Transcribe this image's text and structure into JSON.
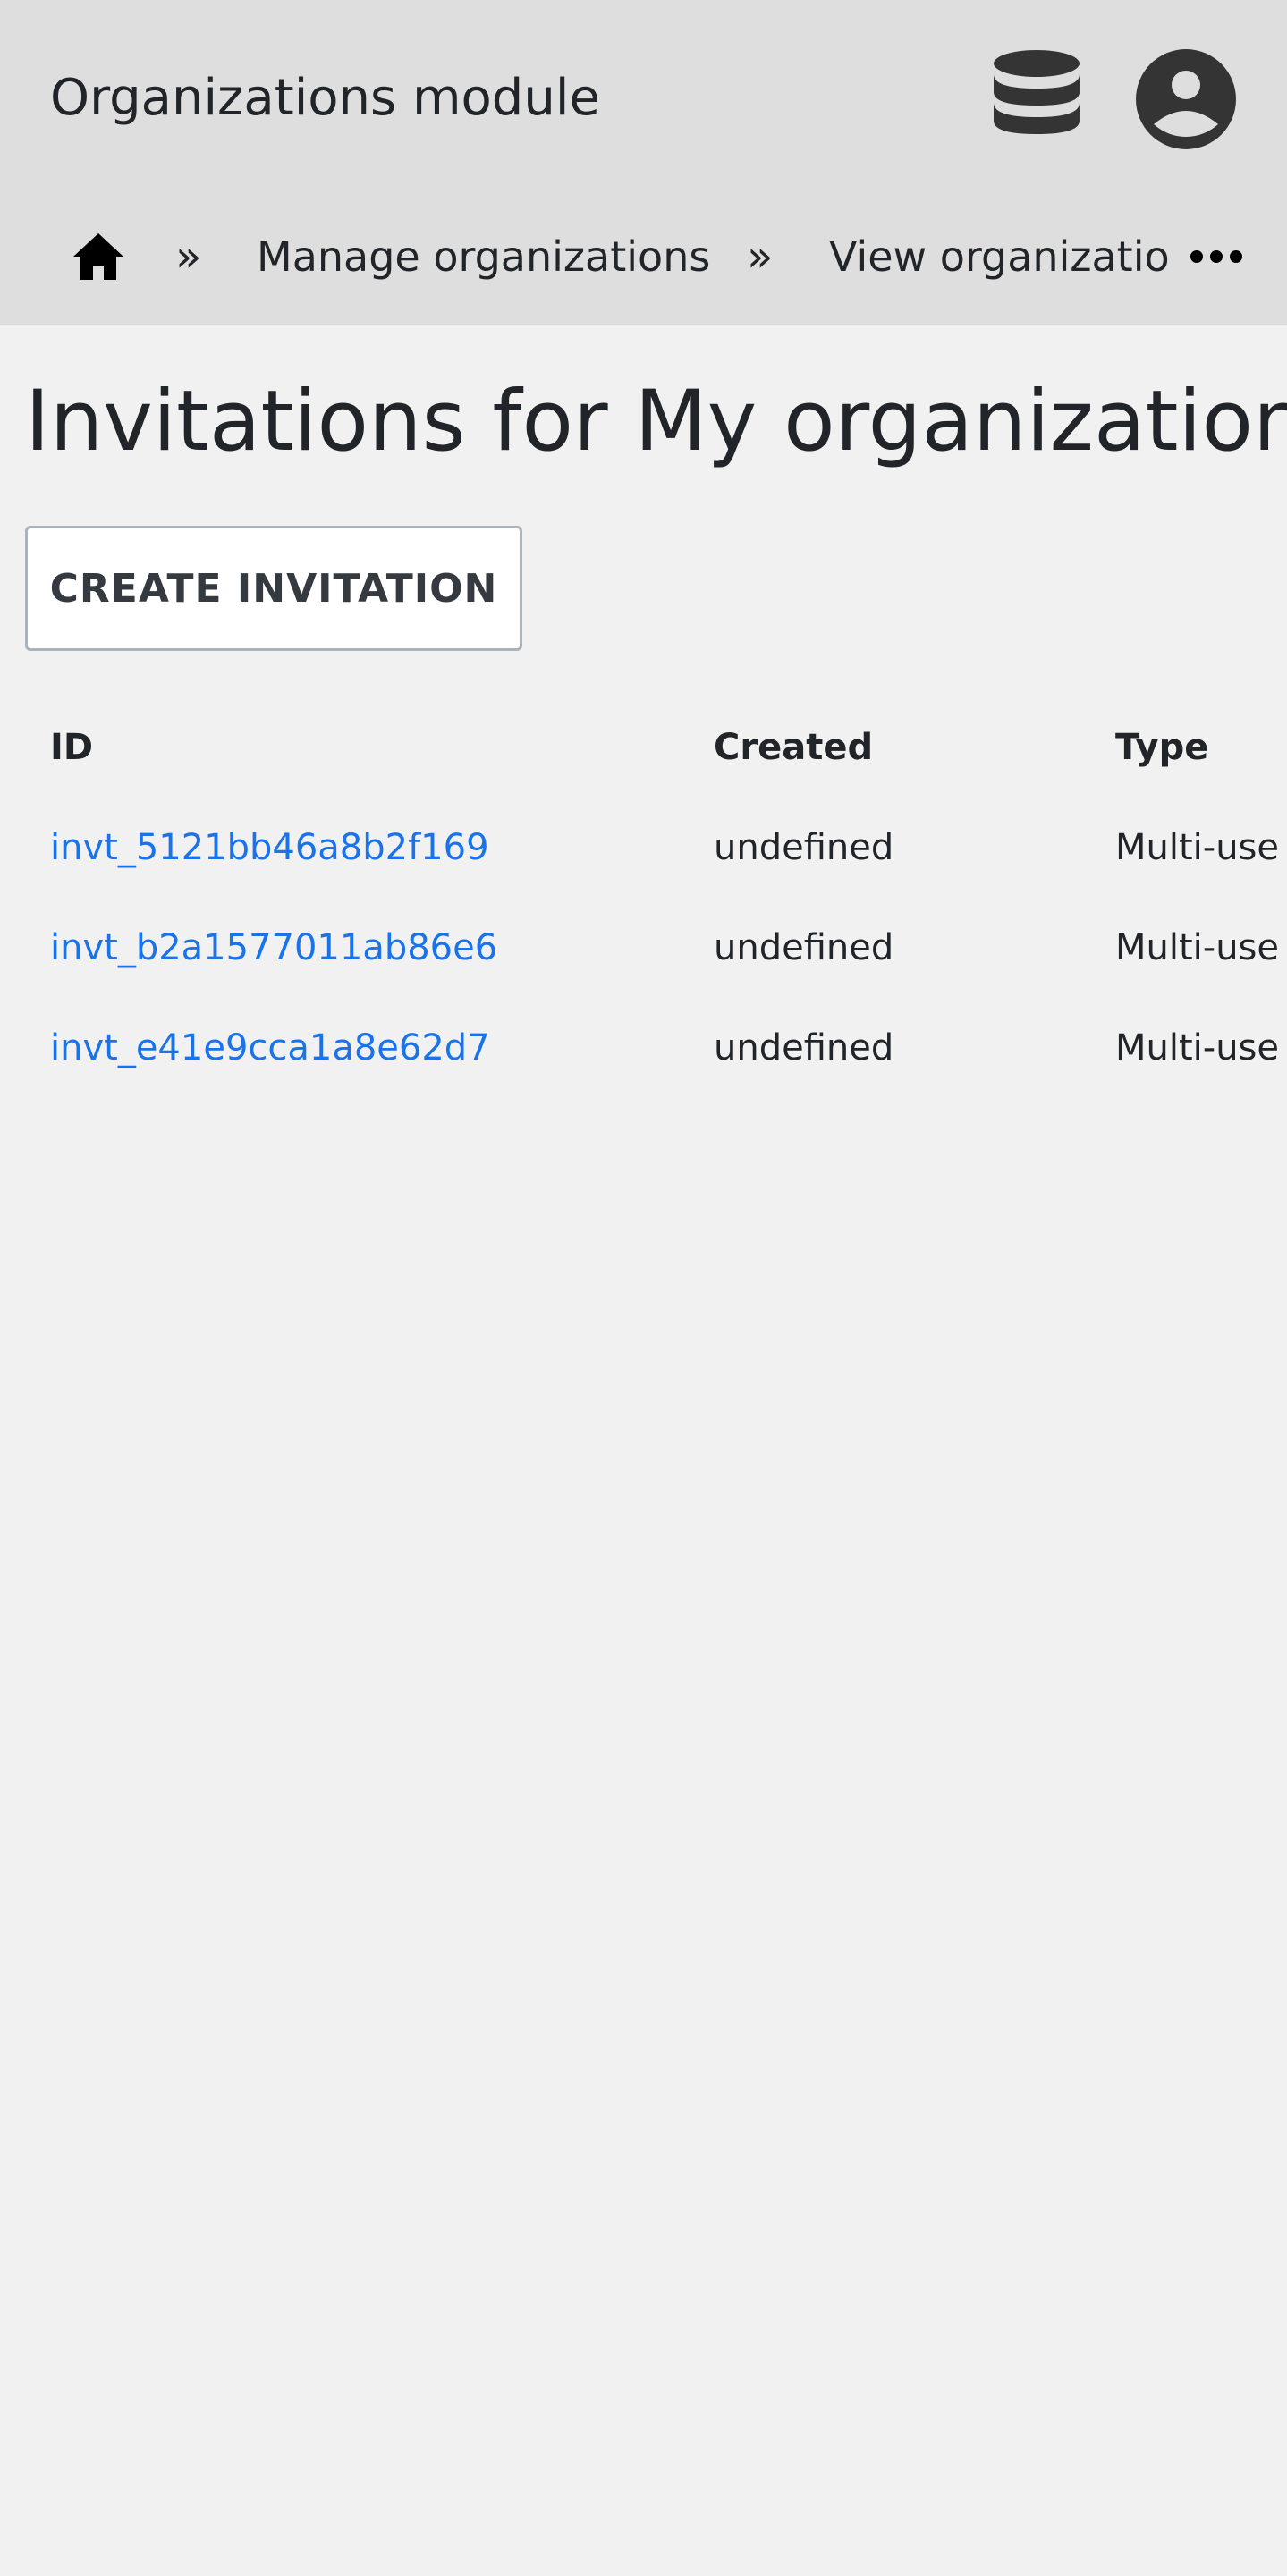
{
  "header": {
    "app_title": "Organizations module",
    "icons": [
      "database-icon",
      "account-circle-icon"
    ]
  },
  "breadcrumb": {
    "home_icon": "home-icon",
    "separator": "»",
    "items": [
      "Manage organizations",
      "View organization"
    ],
    "more_label": "•••"
  },
  "main": {
    "heading": "Invitations for My organization",
    "create_button_label": "CREATE INVITATION"
  },
  "table": {
    "columns": [
      "ID",
      "Created",
      "Type"
    ],
    "rows": [
      {
        "id": "invt_5121bb46a8b2f169",
        "created": "undefined",
        "type": "Multi-use"
      },
      {
        "id": "invt_b2a1577011ab86e6",
        "created": "undefined",
        "type": "Multi-use"
      },
      {
        "id": "invt_e41e9cca1a8e62d7",
        "created": "undefined",
        "type": "Multi-use"
      }
    ]
  },
  "colors": {
    "header_bg": "#dedede",
    "page_bg": "#f1f1f1",
    "link": "#1a73e8",
    "text": "#212529"
  }
}
